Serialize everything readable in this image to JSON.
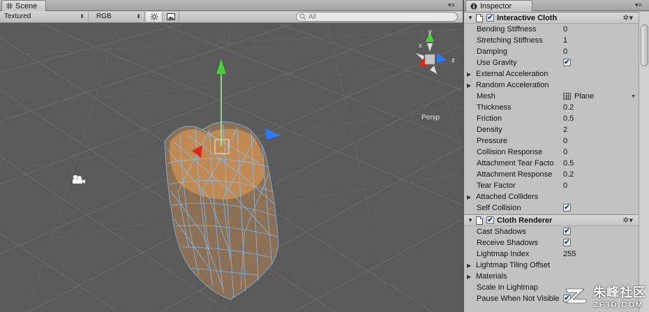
{
  "scene": {
    "tab_label": "Scene",
    "toolbar": {
      "draw_mode": "Textured",
      "render_mode": "RGB",
      "search_placeholder": "All"
    },
    "gizmo_label": "Persp",
    "axis_labels": {
      "x": "x",
      "y": "y",
      "z": "z"
    }
  },
  "inspector": {
    "tab_label": "Inspector",
    "interactive_cloth": {
      "title": "Interactive Cloth",
      "enabled": true,
      "properties": [
        {
          "label": "Bending Stiffness",
          "value": "0"
        },
        {
          "label": "Stretching Stiffness",
          "value": "1"
        },
        {
          "label": "Damping",
          "value": "0"
        },
        {
          "label": "Use Gravity",
          "checked": true
        },
        {
          "label": "External Acceleration",
          "foldout": true
        },
        {
          "label": "Random Acceleration",
          "foldout": true
        },
        {
          "label": "Mesh",
          "value": "Plane",
          "object": true
        },
        {
          "label": "Thickness",
          "value": "0.2"
        },
        {
          "label": "Friction",
          "value": "0.5"
        },
        {
          "label": "Density",
          "value": "2"
        },
        {
          "label": "Pressure",
          "value": "0"
        },
        {
          "label": "Collision Response",
          "value": "0"
        },
        {
          "label": "Attachment Tear Facto",
          "value": "0.5"
        },
        {
          "label": "Attachment Response",
          "value": "0.2"
        },
        {
          "label": "Tear Factor",
          "value": "0"
        },
        {
          "label": "Attached Colliders",
          "foldout": true
        },
        {
          "label": "Self Collision",
          "checked": true
        }
      ]
    },
    "cloth_renderer": {
      "title": "Cloth Renderer",
      "enabled": true,
      "properties": [
        {
          "label": "Cast Shadows",
          "checked": true
        },
        {
          "label": "Receive Shadows",
          "checked": true
        },
        {
          "label": "Lightmap Index",
          "value": "255"
        },
        {
          "label": "Lightmap Tiling Offset",
          "foldout": true
        },
        {
          "label": "Materials",
          "foldout": true
        },
        {
          "label": "Scale In Lightmap",
          "value": ""
        },
        {
          "label": "Pause When Not Visible",
          "checked": true
        }
      ]
    }
  },
  "watermark": {
    "brand": "朱峰社区",
    "url": "ZF3D.COM"
  },
  "colors": {
    "scene_bg": "#5a5a5a",
    "inspector_bg": "#c2c2c2",
    "cloth_wire": "#6fb8ff",
    "cloth_fill": "#b98552"
  }
}
